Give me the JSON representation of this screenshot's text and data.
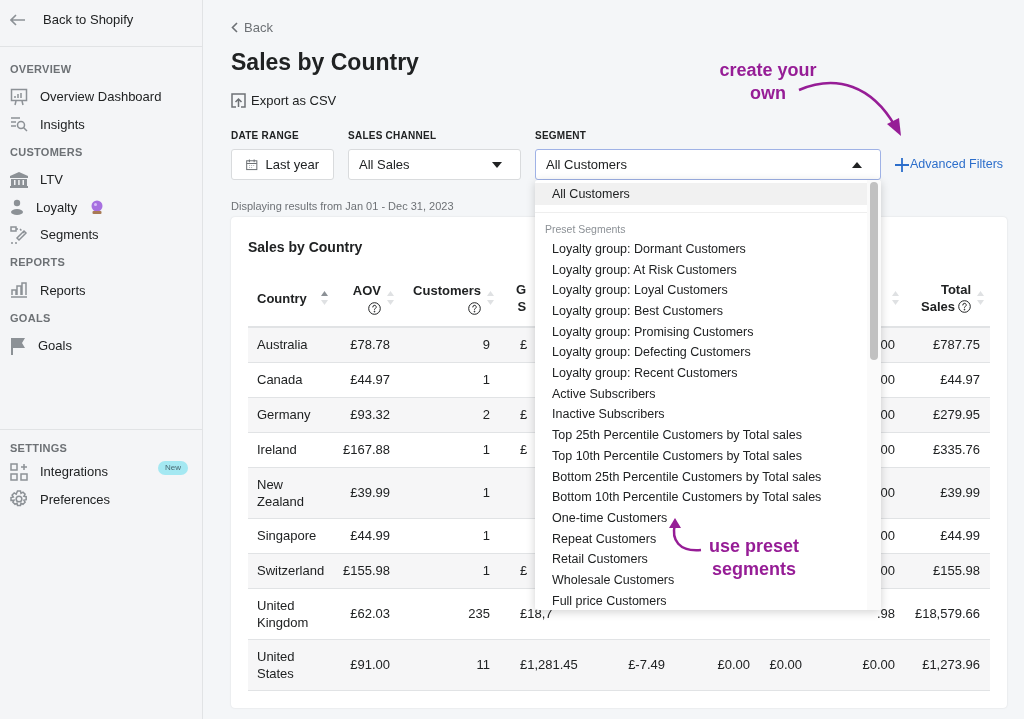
{
  "sidebar": {
    "back": "Back to Shopify",
    "sections": [
      {
        "title": "OVERVIEW",
        "items": [
          {
            "label": "Overview Dashboard"
          },
          {
            "label": "Insights"
          }
        ]
      },
      {
        "title": "CUSTOMERS",
        "items": [
          {
            "label": "LTV"
          },
          {
            "label": "Loyalty"
          },
          {
            "label": "Segments"
          }
        ]
      },
      {
        "title": "REPORTS",
        "items": [
          {
            "label": "Reports"
          }
        ]
      },
      {
        "title": "GOALS",
        "items": [
          {
            "label": "Goals"
          }
        ]
      }
    ],
    "settings": {
      "title": "SETTINGS",
      "items": [
        {
          "label": "Integrations",
          "badge": "New"
        },
        {
          "label": "Preferences"
        }
      ]
    }
  },
  "header": {
    "back": "Back",
    "title": "Sales by Country",
    "export": "Export as CSV"
  },
  "filters": [
    {
      "label": "DATE RANGE",
      "value": "Last year",
      "kind": "date"
    },
    {
      "label": "SALES CHANNEL",
      "value": "All Sales",
      "kind": "select",
      "expanded": false
    },
    {
      "label": "SEGMENT",
      "value": "All Customers",
      "kind": "select",
      "expanded": true,
      "menu": {
        "items": [
          {
            "label": "All Customers",
            "selected": true
          }
        ],
        "group": "Preset Segments",
        "group_items": [
          {
            "label": "Loyalty group: Dormant Customers",
            "selected": false
          },
          {
            "label": "Loyalty group: At Risk Customers",
            "selected": false
          },
          {
            "label": "Loyalty group: Loyal Customers",
            "selected": false
          },
          {
            "label": "Loyalty group: Best Customers",
            "selected": false
          },
          {
            "label": "Loyalty group: Promising Customers",
            "selected": false
          },
          {
            "label": "Loyalty group: Defecting Customers",
            "selected": false
          },
          {
            "label": "Loyalty group: Recent Customers",
            "selected": false
          },
          {
            "label": "Active Subscribers",
            "selected": false
          },
          {
            "label": "Inactive Subscribers",
            "selected": false
          },
          {
            "label": "Top 25th Percentile Customers by Total sales",
            "selected": false
          },
          {
            "label": "Top 10th Percentile Customers by Total sales",
            "selected": false
          },
          {
            "label": "Bottom 25th Percentile Customers by Total sales",
            "selected": false
          },
          {
            "label": "Bottom 10th Percentile Customers by Total sales",
            "selected": false
          },
          {
            "label": "One-time Customers",
            "selected": false
          },
          {
            "label": "Repeat Customers",
            "selected": false
          },
          {
            "label": "Retail Customers",
            "selected": false
          },
          {
            "label": "Wholesale Customers",
            "selected": false
          },
          {
            "label": "Full price Customers",
            "selected": false
          }
        ]
      }
    }
  ],
  "advanced_filters": "Advanced Filters",
  "range_note": "Displaying results from Jan 01 - Dec 31, 2023",
  "card": {
    "title": "Sales by Country",
    "table": {
      "columns": [
        {
          "lines": [
            "Country"
          ],
          "sorted": true
        },
        {
          "lines": [
            "AOV"
          ],
          "sorted": false,
          "help": true
        },
        {
          "lines": [
            "Customers"
          ],
          "sorted": false,
          "help": true
        },
        {
          "lines": [
            "G",
            "S"
          ]
        },
        {},
        {},
        {},
        {
          "sorted": false
        },
        {
          "lines": [
            "Total",
            "Sales"
          ],
          "sorted": false,
          "help": true
        }
      ],
      "rows": [
        {
          "cells": [
            "Australia",
            "£78.78",
            "9",
            "£",
            null,
            null,
            null,
            "00",
            "£787.75"
          ]
        },
        {
          "cells": [
            "Canada",
            "£44.97",
            "1",
            null,
            null,
            null,
            null,
            "00",
            "£44.97"
          ]
        },
        {
          "cells": [
            "Germany",
            "£93.32",
            "2",
            "£",
            null,
            null,
            null,
            "00",
            "£279.95"
          ]
        },
        {
          "cells": [
            "Ireland",
            "£167.88",
            "1",
            "£",
            null,
            null,
            null,
            "00",
            "£335.76"
          ]
        },
        {
          "cells": [
            "New Zealand",
            "£39.99",
            "1",
            null,
            null,
            null,
            null,
            "00",
            "£39.99"
          ]
        },
        {
          "cells": [
            "Singapore",
            "£44.99",
            "1",
            null,
            null,
            null,
            null,
            "00",
            "£44.99"
          ]
        },
        {
          "cells": [
            "Switzerland",
            "£155.98",
            "1",
            "£",
            null,
            null,
            null,
            "00",
            "£155.98"
          ]
        },
        {
          "cells": [
            "United Kingdom",
            "£62.03",
            "235",
            "£18,7",
            null,
            null,
            null,
            ".98",
            "£18,579.66"
          ]
        },
        {
          "cells": [
            "United States",
            "£91.00",
            "11",
            "£1,281.45",
            "£-7.49",
            "£0.00",
            "£0.00",
            "£0.00",
            "£1,273.96"
          ]
        }
      ]
    }
  },
  "annotations": [
    {
      "text": "create your own"
    },
    {
      "text": "use preset segments"
    }
  ]
}
